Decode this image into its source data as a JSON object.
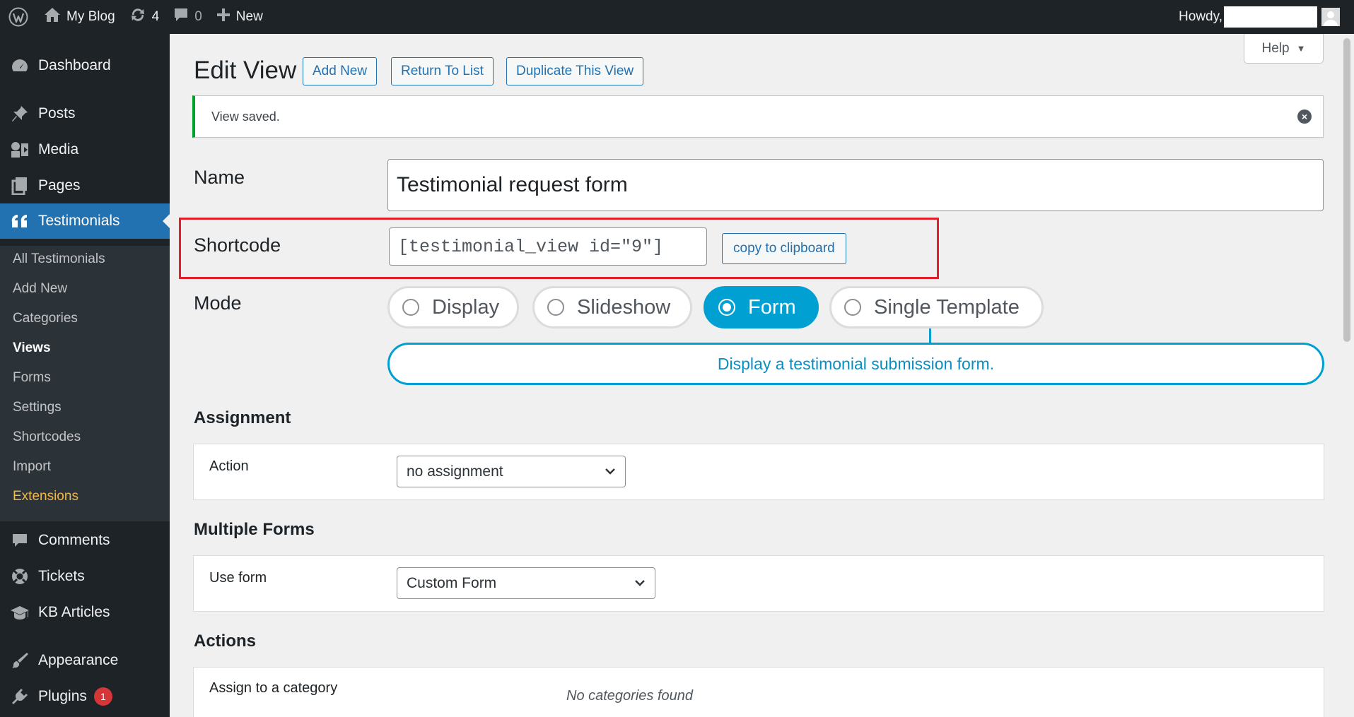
{
  "admin_bar": {
    "site_name": "My Blog",
    "updates_count": "4",
    "comments_count": "0",
    "new_label": "New",
    "howdy": "Howdy,"
  },
  "sidebar": {
    "dashboard": "Dashboard",
    "posts": "Posts",
    "media": "Media",
    "pages": "Pages",
    "testimonials": "Testimonials",
    "submenu": [
      "All Testimonials",
      "Add New",
      "Categories",
      "Views",
      "Forms",
      "Settings",
      "Shortcodes",
      "Import",
      "Extensions"
    ],
    "comments": "Comments",
    "tickets": "Tickets",
    "kb_articles": "KB Articles",
    "appearance": "Appearance",
    "plugins": "Plugins",
    "plugins_badge": "1"
  },
  "header": {
    "help": "Help",
    "title": "Edit View",
    "add_new": "Add New",
    "return_to_list": "Return To List",
    "duplicate": "Duplicate This View"
  },
  "notice": {
    "message": "View saved."
  },
  "form": {
    "name_label": "Name",
    "name_value": "Testimonial request form",
    "shortcode_label": "Shortcode",
    "shortcode_value": "[testimonial_view id=\"9\"]",
    "copy_button": "copy to clipboard",
    "mode_label": "Mode",
    "modes": [
      "Display",
      "Slideshow",
      "Form",
      "Single Template"
    ],
    "selected_mode": "Form",
    "mode_description": "Display a testimonial submission form."
  },
  "assignment": {
    "title": "Assignment",
    "action_label": "Action",
    "action_value": "no assignment"
  },
  "multiple_forms": {
    "title": "Multiple Forms",
    "use_form_label": "Use form",
    "use_form_value": "Custom Form"
  },
  "actions": {
    "title": "Actions",
    "assign_label": "Assign to a category",
    "empty": "No categories found"
  },
  "colors": {
    "admin_dark": "#1d2327",
    "primary": "#2271b1",
    "mode_accent": "#00a0d2",
    "success": "#00a32a",
    "highlight": "#e0212b"
  }
}
